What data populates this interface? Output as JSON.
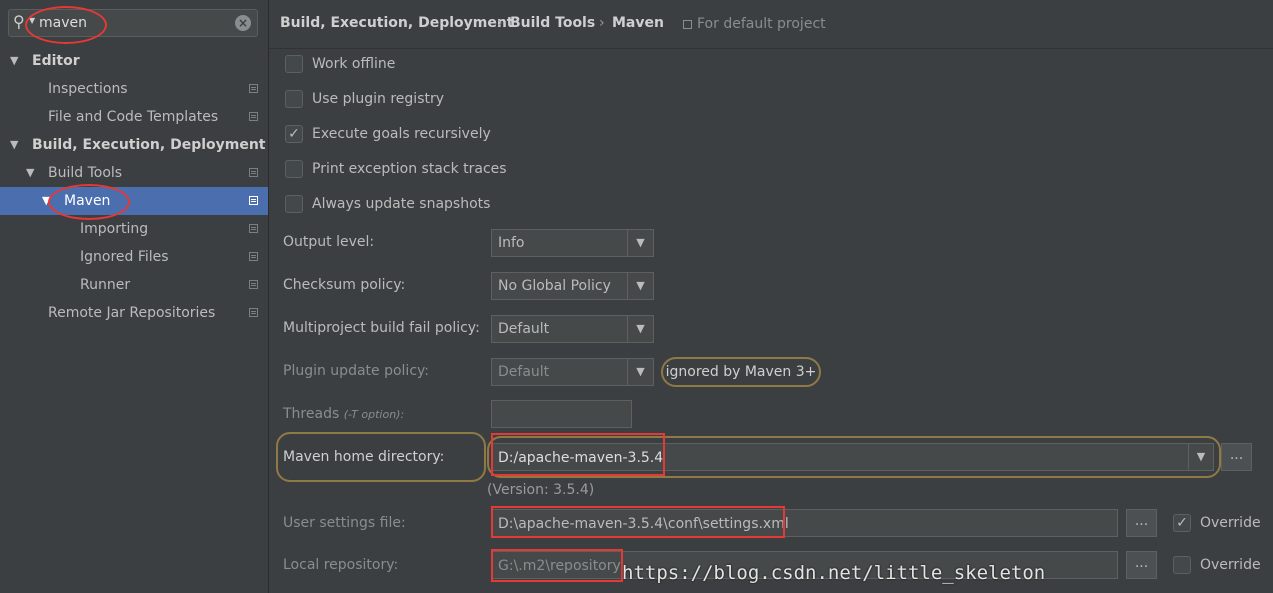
{
  "search": {
    "value": "maven",
    "search_icon": "magnifier",
    "clear_icon": "clear"
  },
  "sidebar": {
    "items": [
      {
        "label": "Editor",
        "level": 0,
        "bold": true,
        "expanded": true
      },
      {
        "label": "Inspections",
        "level": 1
      },
      {
        "label": "File and Code Templates",
        "level": 1
      },
      {
        "label": "Build, Execution, Deployment",
        "level": 0,
        "bold": true,
        "expanded": true
      },
      {
        "label": "Build Tools",
        "level": 1,
        "expanded": true
      },
      {
        "label": "Maven",
        "level": 2,
        "expanded": true,
        "selected": true
      },
      {
        "label": "Importing",
        "level": 3
      },
      {
        "label": "Ignored Files",
        "level": 3
      },
      {
        "label": "Runner",
        "level": 3
      },
      {
        "label": "Remote Jar Repositories",
        "level": 1
      }
    ]
  },
  "breadcrumb": {
    "parts": [
      "Build, Execution, Deployment",
      "Build Tools",
      "Maven"
    ],
    "separator": "›",
    "default_project": "For default project"
  },
  "checkboxes": [
    {
      "label": "Work offline",
      "checked": false
    },
    {
      "label": "Use plugin registry",
      "checked": false
    },
    {
      "label": "Execute goals recursively",
      "checked": true
    },
    {
      "label": "Print exception stack traces",
      "checked": false
    },
    {
      "label": "Always update snapshots",
      "checked": false
    }
  ],
  "output_level": {
    "label": "Output level:",
    "value": "Info"
  },
  "checksum_policy": {
    "label": "Checksum policy:",
    "value": "No Global Policy"
  },
  "multiproject_policy": {
    "label": "Multiproject build fail policy:",
    "value": "Default"
  },
  "plugin_update_policy": {
    "label": "Plugin update policy:",
    "value": "Default",
    "note": "ignored by Maven 3+"
  },
  "threads": {
    "label": "Threads",
    "hint": "(-T option):",
    "value": ""
  },
  "maven_home": {
    "label": "Maven home directory:",
    "value": "D:/apache-maven-3.5.4",
    "version": "(Version: 3.5.4)",
    "browse": "..."
  },
  "user_settings": {
    "label": "User settings file:",
    "value": "D:\\apache-maven-3.5.4\\conf\\settings.xml",
    "browse": "...",
    "override_label": "Override",
    "override_checked": true
  },
  "local_repo": {
    "label": "Local repository:",
    "value": "G:\\.m2\\repository",
    "browse": "...",
    "override_label": "Override",
    "override_checked": false
  },
  "watermark": "https://blog.csdn.net/little_skeleton",
  "colors": {
    "selection": "#4b6eaf",
    "background": "#3c3f41",
    "annotation_red": "#e53935",
    "highlight": "#8f7a45"
  }
}
